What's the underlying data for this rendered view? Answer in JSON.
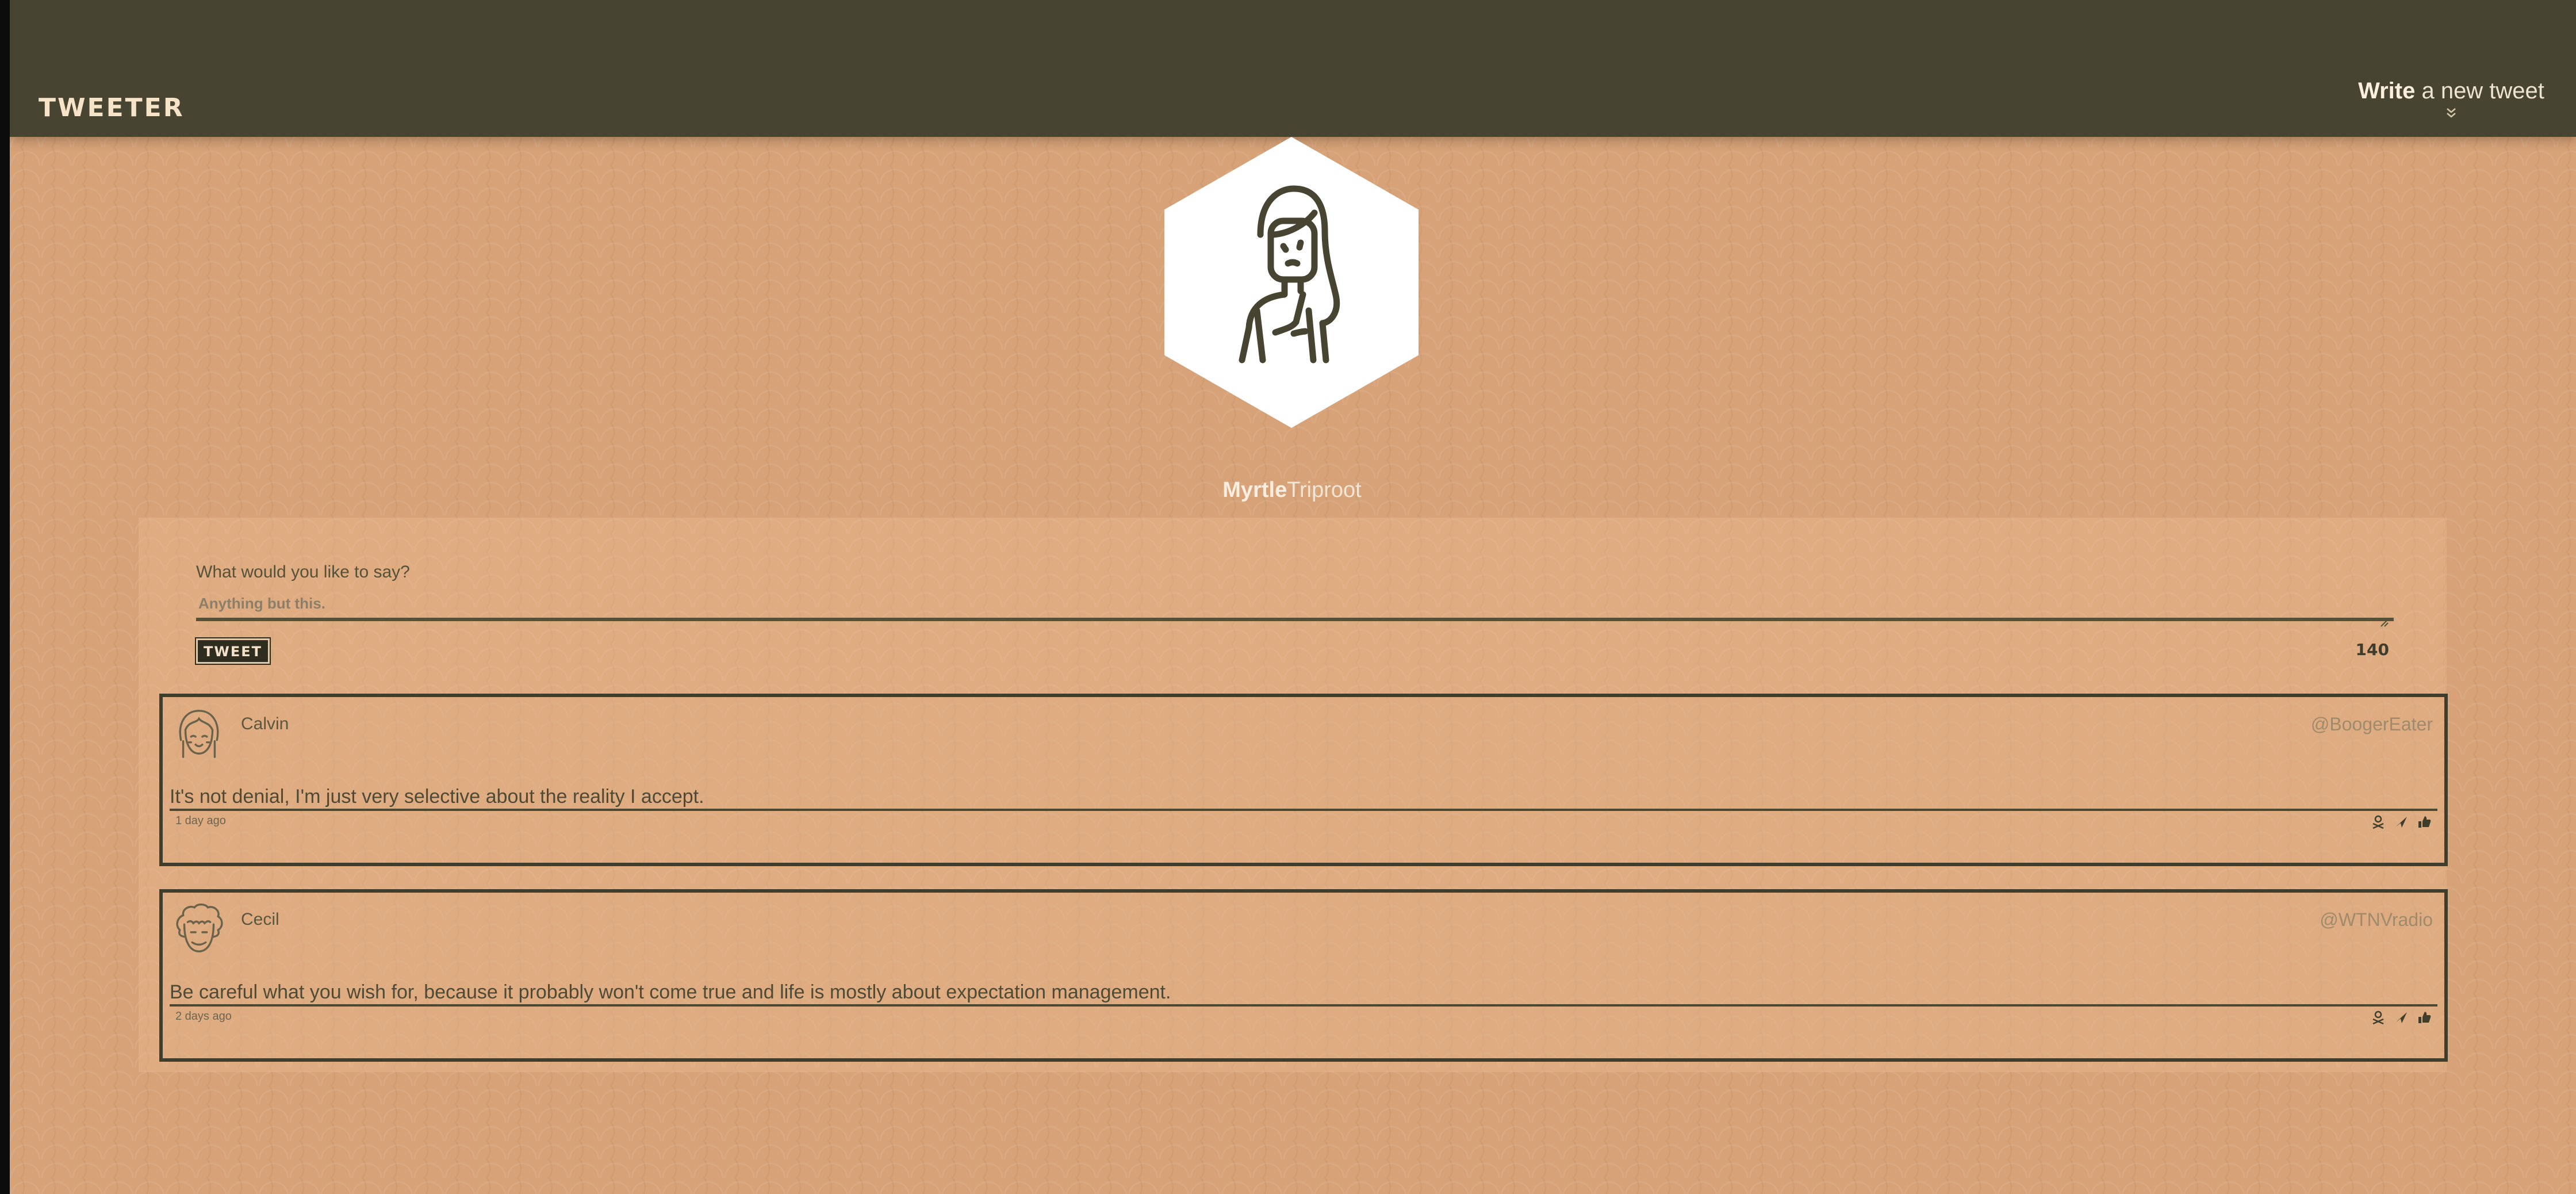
{
  "nav": {
    "brand": "TWEETER",
    "compose_toggle": {
      "bold": "Write",
      "rest": " a new tweet",
      "icon": "double-chevron-down-icon"
    }
  },
  "profile": {
    "avatar_icon": "woman-avatar-icon",
    "first_name": "Myrtle",
    "last_name": "Triproot"
  },
  "composer": {
    "label": "What would you like to say?",
    "placeholder": "Anything but this.",
    "value": "",
    "submit_label": "TWEET",
    "char_counter": "140"
  },
  "tweets": [
    {
      "author": "Calvin",
      "handle": "@BoogerEater",
      "avatar_icon": "girl-avatar-icon",
      "content": "It's not denial, I'm just very selective about the reality I accept.",
      "time": "1 day ago",
      "actions": [
        "flag-icon",
        "retweet-icon",
        "like-icon"
      ]
    },
    {
      "author": "Cecil",
      "handle": "@WTNVradio",
      "avatar_icon": "curly-man-avatar-icon",
      "content": "Be careful what you wish for, because it probably won't come true and life is mostly about expectation management.",
      "time": "2 days ago",
      "actions": [
        "flag-icon",
        "retweet-icon",
        "like-icon"
      ]
    }
  ],
  "colors": {
    "nav_bg": "#474431",
    "page_bg": "#d7a277",
    "ink": "#3f3d2b",
    "accent_text": "#f7e3c8"
  }
}
